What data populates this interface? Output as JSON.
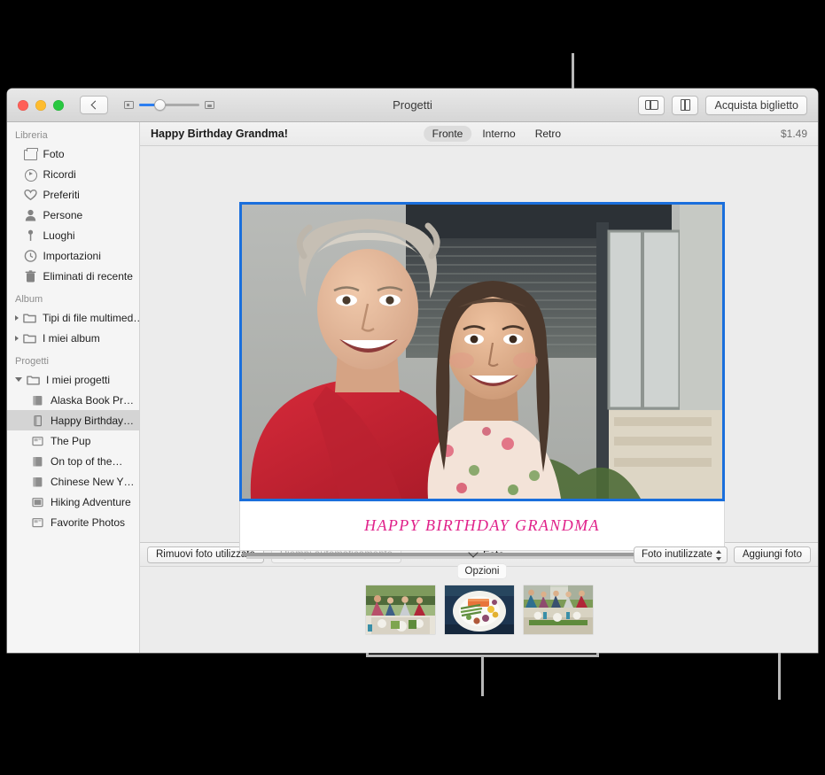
{
  "window": {
    "title": "Progetti",
    "traffic_lights": [
      "close",
      "minimize",
      "zoom"
    ],
    "back_button": "back-chevron",
    "zoom_slider": {
      "min_icon": "small-thumbnail-icon",
      "max_icon": "large-thumbnail-icon",
      "value_percent": 33
    },
    "toolbar_right": {
      "sidebar_toggle": "sidebar-icon",
      "card_preview": "card-icon",
      "buy_label": "Acquista biglietto"
    }
  },
  "sidebar": {
    "sections": [
      {
        "header": "Libreria",
        "items": [
          {
            "label": "Foto",
            "icon": "photos-icon",
            "indent": 1,
            "disclosure": "none",
            "selected": false
          },
          {
            "label": "Ricordi",
            "icon": "memories-icon",
            "indent": 1,
            "disclosure": "none",
            "selected": false
          },
          {
            "label": "Preferiti",
            "icon": "heart-icon",
            "indent": 1,
            "disclosure": "none",
            "selected": false
          },
          {
            "label": "Persone",
            "icon": "person-icon",
            "indent": 1,
            "disclosure": "none",
            "selected": false
          },
          {
            "label": "Luoghi",
            "icon": "pin-icon",
            "indent": 1,
            "disclosure": "none",
            "selected": false
          },
          {
            "label": "Importazioni",
            "icon": "clock-icon",
            "indent": 1,
            "disclosure": "none",
            "selected": false
          },
          {
            "label": "Eliminati di recente",
            "icon": "trash-icon",
            "indent": 1,
            "disclosure": "none",
            "selected": false
          }
        ]
      },
      {
        "header": "Album",
        "items": [
          {
            "label": "Tipi di file multimed…",
            "icon": "folder-icon",
            "indent": 1,
            "disclosure": "closed",
            "selected": false
          },
          {
            "label": "I miei album",
            "icon": "folder-icon",
            "indent": 1,
            "disclosure": "closed",
            "selected": false
          }
        ]
      },
      {
        "header": "Progetti",
        "items": [
          {
            "label": "I miei progetti",
            "icon": "folder-icon",
            "indent": 1,
            "disclosure": "open",
            "selected": false
          },
          {
            "label": "Alaska Book Pr…",
            "icon": "book-icon",
            "indent": 2,
            "disclosure": "none",
            "selected": false
          },
          {
            "label": "Happy Birthday…",
            "icon": "card-fold-icon",
            "indent": 2,
            "disclosure": "none",
            "selected": true
          },
          {
            "label": "The Pup",
            "icon": "slideshow-icon",
            "indent": 2,
            "disclosure": "none",
            "selected": false
          },
          {
            "label": "On top of the…",
            "icon": "book-icon",
            "indent": 2,
            "disclosure": "none",
            "selected": false
          },
          {
            "label": "Chinese New Y…",
            "icon": "book-icon",
            "indent": 2,
            "disclosure": "none",
            "selected": false
          },
          {
            "label": "Hiking Adventure",
            "icon": "card-fill-icon",
            "indent": 2,
            "disclosure": "none",
            "selected": false
          },
          {
            "label": "Favorite Photos",
            "icon": "slideshow-icon",
            "indent": 2,
            "disclosure": "none",
            "selected": false
          }
        ]
      }
    ]
  },
  "content_header": {
    "project_title": "Happy Birthday Grandma!",
    "segments": [
      {
        "label": "Fronte",
        "active": true
      },
      {
        "label": "Interno",
        "active": false
      },
      {
        "label": "Retro",
        "active": false
      }
    ],
    "price": "$1.49"
  },
  "card": {
    "selection_color": "#1a6fdc",
    "caption_text": "HAPPY BIRTHDAY GRANDMA",
    "caption_color": "#e0218a",
    "options_button": "Opzioni",
    "photo_description": "grandmother-and-granddaughter-photo"
  },
  "bottom_toolbar": {
    "remove_used_photos": "Rimuovi foto utilizzate",
    "autofill": "Riempi automaticamente",
    "autofill_disabled": true,
    "photos_disclosure_icon": "chevron-down-icon",
    "photos_label": "Foto",
    "filter_popup": "Foto inutilizzate",
    "add_photos": "Aggiungi foto"
  },
  "photo_tray": {
    "thumbnails": [
      {
        "name": "outdoor-dinner-party-photo"
      },
      {
        "name": "plated-salmon-dish-photo"
      },
      {
        "name": "family-at-long-table-photo"
      }
    ]
  },
  "callouts": [
    {
      "name": "callout-card-photo",
      "target": "card-photo"
    },
    {
      "name": "callout-photo-tray",
      "target": "photo-tray"
    },
    {
      "name": "callout-add-photos",
      "target": "add-photos-button"
    }
  ]
}
